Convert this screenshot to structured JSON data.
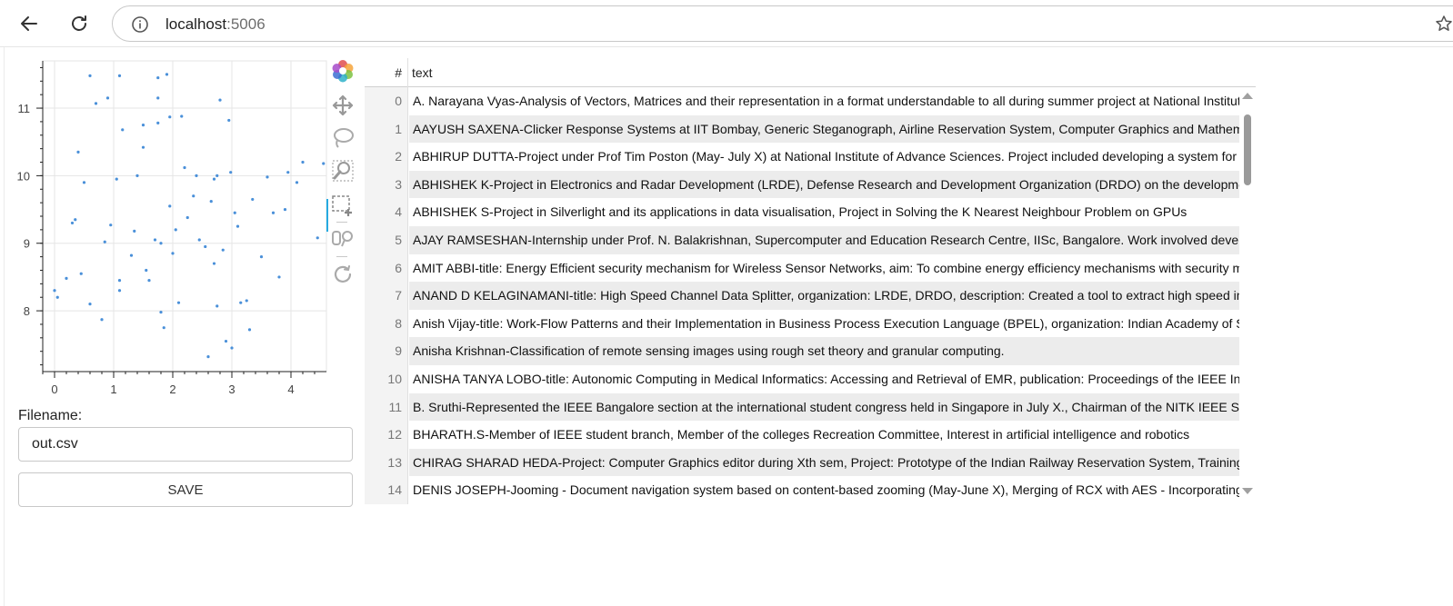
{
  "browser": {
    "url_host": "localhost",
    "url_port": ":5006"
  },
  "plot": {
    "x_ticks": [
      "0",
      "1",
      "2",
      "3",
      "4"
    ],
    "y_ticks": [
      "8",
      "9",
      "10",
      "11"
    ],
    "point_color": "#4a90d9"
  },
  "chart_data": {
    "type": "scatter",
    "xlim": [
      -0.2,
      4.6
    ],
    "ylim": [
      7.1,
      11.7
    ],
    "x": [
      0.0,
      0.05,
      0.2,
      0.3,
      0.35,
      0.4,
      0.45,
      0.5,
      0.6,
      0.6,
      0.7,
      0.8,
      0.85,
      0.9,
      0.95,
      1.05,
      1.1,
      1.1,
      1.1,
      1.15,
      1.3,
      1.35,
      1.4,
      1.5,
      1.5,
      1.55,
      1.6,
      1.7,
      1.75,
      1.75,
      1.75,
      1.8,
      1.8,
      1.85,
      1.9,
      1.95,
      1.95,
      2.0,
      2.05,
      2.1,
      2.15,
      2.2,
      2.25,
      2.35,
      2.4,
      2.45,
      2.55,
      2.6,
      2.65,
      2.7,
      2.7,
      2.75,
      2.75,
      2.8,
      2.85,
      2.9,
      2.95,
      2.98,
      3.0,
      3.05,
      3.1,
      3.15,
      3.25,
      3.3,
      3.35,
      3.5,
      3.6,
      3.7,
      3.8,
      3.9,
      3.95,
      4.1,
      4.2,
      4.45,
      4.55
    ],
    "y": [
      8.3,
      8.2,
      8.48,
      9.3,
      9.35,
      10.35,
      8.55,
      9.9,
      8.1,
      11.48,
      11.07,
      7.87,
      9.02,
      11.15,
      9.27,
      9.95,
      8.3,
      8.45,
      11.48,
      10.68,
      8.82,
      9.18,
      10.0,
      10.42,
      10.75,
      8.6,
      8.45,
      9.05,
      11.45,
      11.15,
      10.78,
      9.0,
      7.98,
      7.75,
      11.5,
      10.87,
      9.55,
      8.85,
      9.2,
      8.12,
      10.88,
      10.12,
      9.38,
      9.7,
      10.0,
      9.05,
      8.95,
      7.32,
      9.62,
      9.95,
      8.7,
      8.07,
      10.0,
      11.12,
      8.9,
      7.55,
      10.82,
      10.05,
      7.45,
      9.45,
      9.25,
      8.12,
      8.15,
      7.72,
      9.65,
      8.8,
      9.98,
      9.45,
      8.5,
      9.5,
      10.05,
      9.9,
      10.2,
      9.08,
      10.18,
      9.85
    ],
    "xlabel": "",
    "ylabel": ""
  },
  "toolbar": {
    "icons": [
      "bokeh-logo-icon",
      "pan-icon",
      "lasso-select-icon",
      "zoom-icon",
      "box-select-icon",
      "hover-icon",
      "reset-icon"
    ]
  },
  "form": {
    "filename_label": "Filename:",
    "filename_value": "out.csv",
    "save_label": "SAVE"
  },
  "table": {
    "index_header": "#",
    "text_header": "text",
    "rows": [
      {
        "index": "0",
        "text": "A. Narayana Vyas-Analysis of Vectors, Matrices and their representation in a format understandable to all during summer project at National Institute of A"
      },
      {
        "index": "1",
        "text": "AAYUSH SAXENA-Clicker Response Systems at IIT Bombay, Generic Steganograph, Airline Reservation System, Computer Graphics and Mathematics"
      },
      {
        "index": "2",
        "text": "ABHIRUP DUTTA-Project under Prof Tim Poston (May- July X) at National Institute of Advance Sciences. Project included developing a system for teach"
      },
      {
        "index": "3",
        "text": "ABHISHEK K-Project in Electronics and Radar Development (LRDE), Defense Research and Development Organization (DRDO) on the development of"
      },
      {
        "index": "4",
        "text": "ABHISHEK S-Project in Silverlight and its applications in data visualisation, Project in Solving the K Nearest Neighbour Problem on GPUs"
      },
      {
        "index": "5",
        "text": "AJAY RAMSESHAN-Internship under Prof. N. Balakrishnan, Supercomputer and Education Research Centre, IISc, Bangalore. Work involved developme"
      },
      {
        "index": "6",
        "text": "AMIT ABBI-title: Energy Efficient security mechanism for Wireless Sensor Networks, aim: To combine energy efficiency mechanisms with security measu"
      },
      {
        "index": "7",
        "text": "ANAND D KELAGINAMANI-title: High Speed Channel Data Splitter, organization: LRDE, DRDO, description: Created a tool to extract high speed incom"
      },
      {
        "index": "8",
        "text": "Anish Vijay-title: Work-Flow Patterns and their Implementation in Business Process Execution Language (BPEL), organization: Indian Academy of Scien"
      },
      {
        "index": "9",
        "text": "Anisha Krishnan-Classification of remote sensing images using rough set theory and granular computing."
      },
      {
        "index": "10",
        "text": "ANISHA TANYA LOBO-title: Autonomic Computing in Medical Informatics: Accessing and Retrieval of EMR, publication: Proceedings of the IEEE Interna"
      },
      {
        "index": "11",
        "text": "B. Sruthi-Represented the IEEE Bangalore section at the international student congress held in Singapore in July X., Chairman of the NITK IEEE Studer"
      },
      {
        "index": "12",
        "text": "BHARATH.S-Member of IEEE student branch, Member of the colleges Recreation Committee, Interest in artificial intelligence and robotics"
      },
      {
        "index": "13",
        "text": "CHIRAG SHARAD HEDA-Project: Computer Graphics editor during Xth sem, Project: Prototype of the Indian Railway Reservation System, Training: Net"
      },
      {
        "index": "14",
        "text": "DENIS JOSEPH-Jooming - Document navigation system based on content-based zooming (May-June X), Merging of RCX with AES - Incorporating mor"
      }
    ]
  }
}
